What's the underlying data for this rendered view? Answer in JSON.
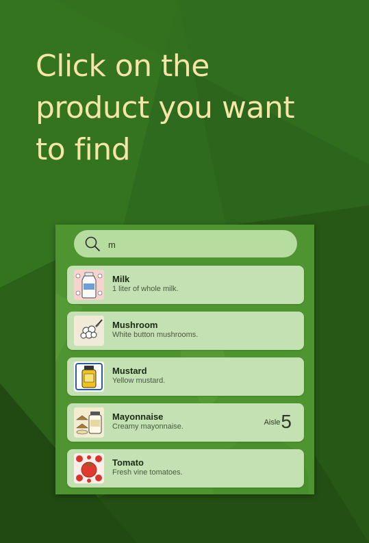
{
  "headline": {
    "line1": "Click on the",
    "line2": "product you want",
    "line3": "to find"
  },
  "search": {
    "value": "m",
    "icon": "search-icon"
  },
  "results": [
    {
      "name": "Milk",
      "description": "1 liter of whole milk.",
      "icon": "milk-bottle-icon"
    },
    {
      "name": "Mushroom",
      "description": "White button mushrooms.",
      "icon": "mushroom-icon"
    },
    {
      "name": "Mustard",
      "description": "Yellow mustard.",
      "icon": "mustard-jar-icon"
    },
    {
      "name": "Mayonnaise",
      "description": "Creamy mayonnaise.",
      "icon": "mayonnaise-jar-icon",
      "aisle_label": "Aisle",
      "aisle_number": "5"
    },
    {
      "name": "Tomato",
      "description": "Fresh vine tomatoes.",
      "icon": "tomato-icon"
    }
  ],
  "colors": {
    "background": "#2f6b1e",
    "headline": "#f5e6a8",
    "panel": "#4e9430",
    "card": "#c3e1b2",
    "search_bar": "#b6dca0"
  }
}
